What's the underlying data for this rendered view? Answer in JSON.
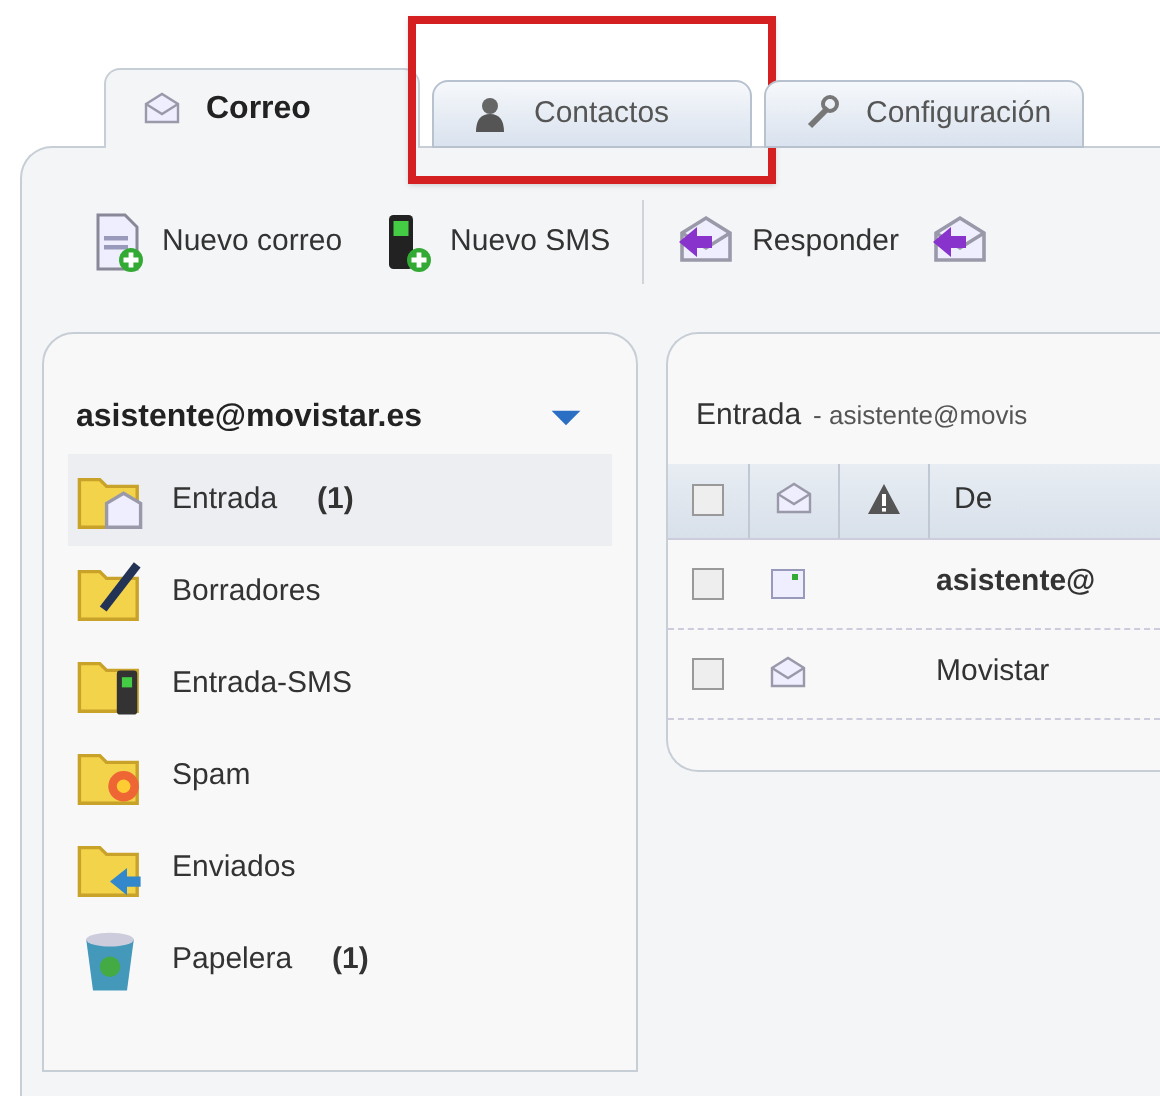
{
  "tabs": [
    {
      "label": "Correo",
      "kind": "mail",
      "selected": true
    },
    {
      "label": "Contactos",
      "kind": "contacts",
      "selected": false,
      "highlighted": true
    },
    {
      "label": "Configuración",
      "kind": "settings",
      "selected": false
    }
  ],
  "toolbar": [
    {
      "label": "Nuevo correo",
      "kind": "new-mail"
    },
    {
      "label": "Nuevo SMS",
      "kind": "new-sms"
    },
    {
      "label": "Responder",
      "kind": "reply"
    },
    {
      "kind": "reply-all"
    }
  ],
  "sidebar": {
    "account": "asistente@movistar.es",
    "items": [
      {
        "label": "Entrada",
        "count": "(1)",
        "kind": "inbox",
        "selected": true
      },
      {
        "label": "Borradores",
        "kind": "drafts",
        "selected": false
      },
      {
        "label": "Entrada-SMS",
        "kind": "sms",
        "selected": false
      },
      {
        "label": "Spam",
        "kind": "spam",
        "selected": false
      },
      {
        "label": "Enviados",
        "kind": "sent",
        "selected": false
      },
      {
        "label": "Papelera",
        "count": "(1)",
        "kind": "trash",
        "selected": false
      }
    ]
  },
  "message_list": {
    "title": "Entrada",
    "subtitle": "- asistente@movis",
    "columns": [
      {
        "kind": "checkbox",
        "checked": false
      },
      {
        "kind": "read-status"
      },
      {
        "kind": "priority"
      },
      {
        "kind": "text",
        "label": "De"
      }
    ],
    "rows": [
      {
        "from": "asistente@",
        "kind": "sms",
        "unread": true,
        "checked": false
      },
      {
        "from": "Movistar",
        "kind": "mail",
        "unread": false,
        "checked": false
      }
    ]
  }
}
